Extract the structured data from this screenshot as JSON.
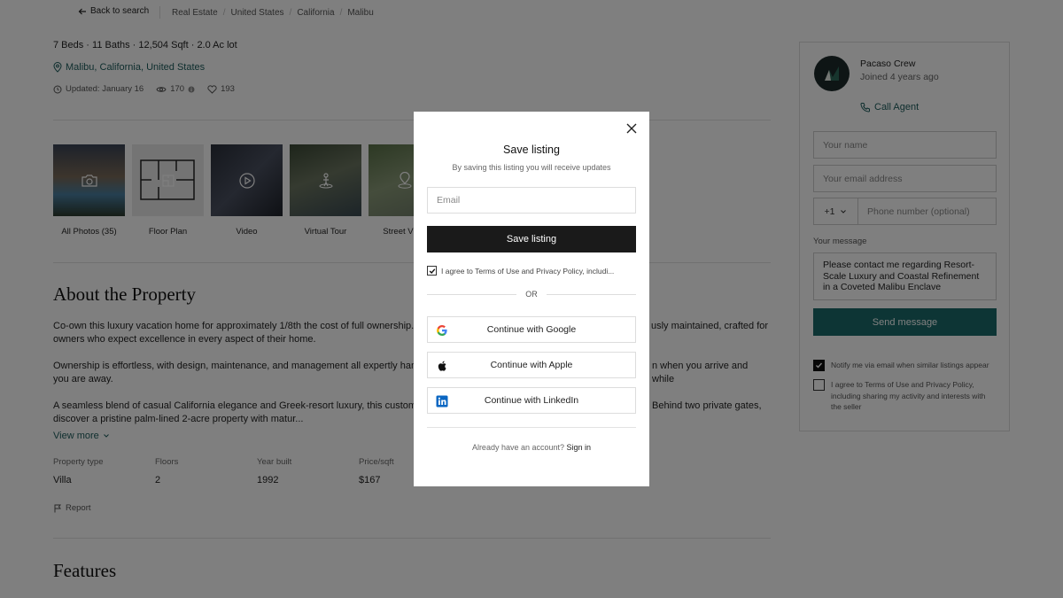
{
  "topbar": {
    "back_label": "Back to search",
    "breadcrumbs": [
      "Real Estate",
      "United States",
      "California",
      "Malibu"
    ]
  },
  "listing": {
    "specs": "7 Beds · 11 Baths · 12,504 Sqft · 2.0 Ac lot",
    "location": "Malibu, California, United States",
    "updated": "Updated: January 16",
    "views": "170",
    "likes": "193"
  },
  "media": {
    "tabs": [
      "All Photos (35)",
      "Floor Plan",
      "Video",
      "Virtual Tour",
      "Street View"
    ]
  },
  "about": {
    "title": "About the Property",
    "paragraphs": [
      "Co-own this luxury vacation home for approximately 1/8th the cost of full ownership. E",
      "usly maintained, crafted for",
      "owners who expect excellence in every aspect of their home.",
      "Ownership is effortless, with design, maintenance, and management all expertly handl",
      "n when you arrive and while",
      "you are away.",
      "A seamless blend of casual California elegance and Greek-resort luxury, this custom M",
      "Behind two private gates,",
      "discover a pristine palm-lined 2-acre property with matur..."
    ],
    "view_more": "View more"
  },
  "facts": [
    {
      "label": "Property type",
      "value": "Villa"
    },
    {
      "label": "Floors",
      "value": "2"
    },
    {
      "label": "Year built",
      "value": "1992"
    },
    {
      "label": "Price/sqft",
      "value": "$167"
    }
  ],
  "report_label": "Report",
  "features_title": "Features",
  "agent": {
    "name": "Pacaso Crew",
    "joined": "Joined 4 years ago",
    "call_label": "Call Agent"
  },
  "contact_form": {
    "name_placeholder": "Your name",
    "email_placeholder": "Your email address",
    "country_code": "+1",
    "phone_placeholder": "Phone number (optional)",
    "message_label": "Your message",
    "message_value": "Please contact me regarding Resort-Scale Luxury and Coastal Refinement in a Coveted Malibu Enclave",
    "send_label": "Send message",
    "notify_label": "Notify me via email when similar listings appear",
    "agree_label": "I agree to Terms of Use and Privacy Policy, including sharing my activity and interests with the seller"
  },
  "modal": {
    "title": "Save listing",
    "subtitle": "By saving this listing you will receive updates",
    "email_placeholder": "Email",
    "save_label": "Save listing",
    "terms_prefix": "I agree to ",
    "terms_link": "Terms of Use",
    "terms_and": " and ",
    "privacy_link": "Privacy Policy",
    "terms_suffix": ", includi...",
    "or_label": "OR",
    "google_label": "Continue with Google",
    "apple_label": "Continue with Apple",
    "linkedin_label": "Continue with LinkedIn",
    "signin_prefix": "Already have an account? ",
    "signin_link": "Sign in"
  }
}
